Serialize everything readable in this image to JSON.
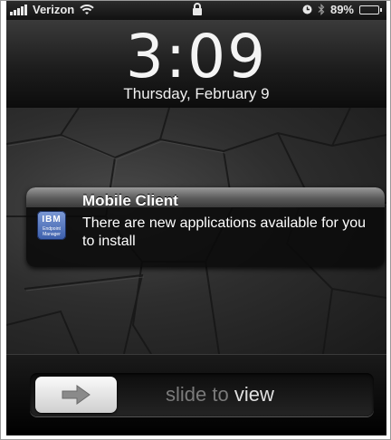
{
  "status_bar": {
    "carrier": "Verizon",
    "battery_percent": "89%",
    "battery_level": 0.89,
    "icons": [
      "signal-bars-icon",
      "wifi-icon",
      "lock-icon",
      "clock-icon",
      "bluetooth-icon",
      "battery-icon"
    ]
  },
  "lock_screen": {
    "time": "3:09",
    "date": "Thursday, February 9"
  },
  "notification": {
    "title": "Mobile Client",
    "message": "There are new applications available for you to install",
    "app_icon_text": "IBM",
    "app_icon_subtext": "Endpoint Manager",
    "app_icon_color": "#3b5eab"
  },
  "slider": {
    "label_prefix": "slide to",
    "label_action": "view",
    "arrow_icon": "arrow-right-icon"
  }
}
